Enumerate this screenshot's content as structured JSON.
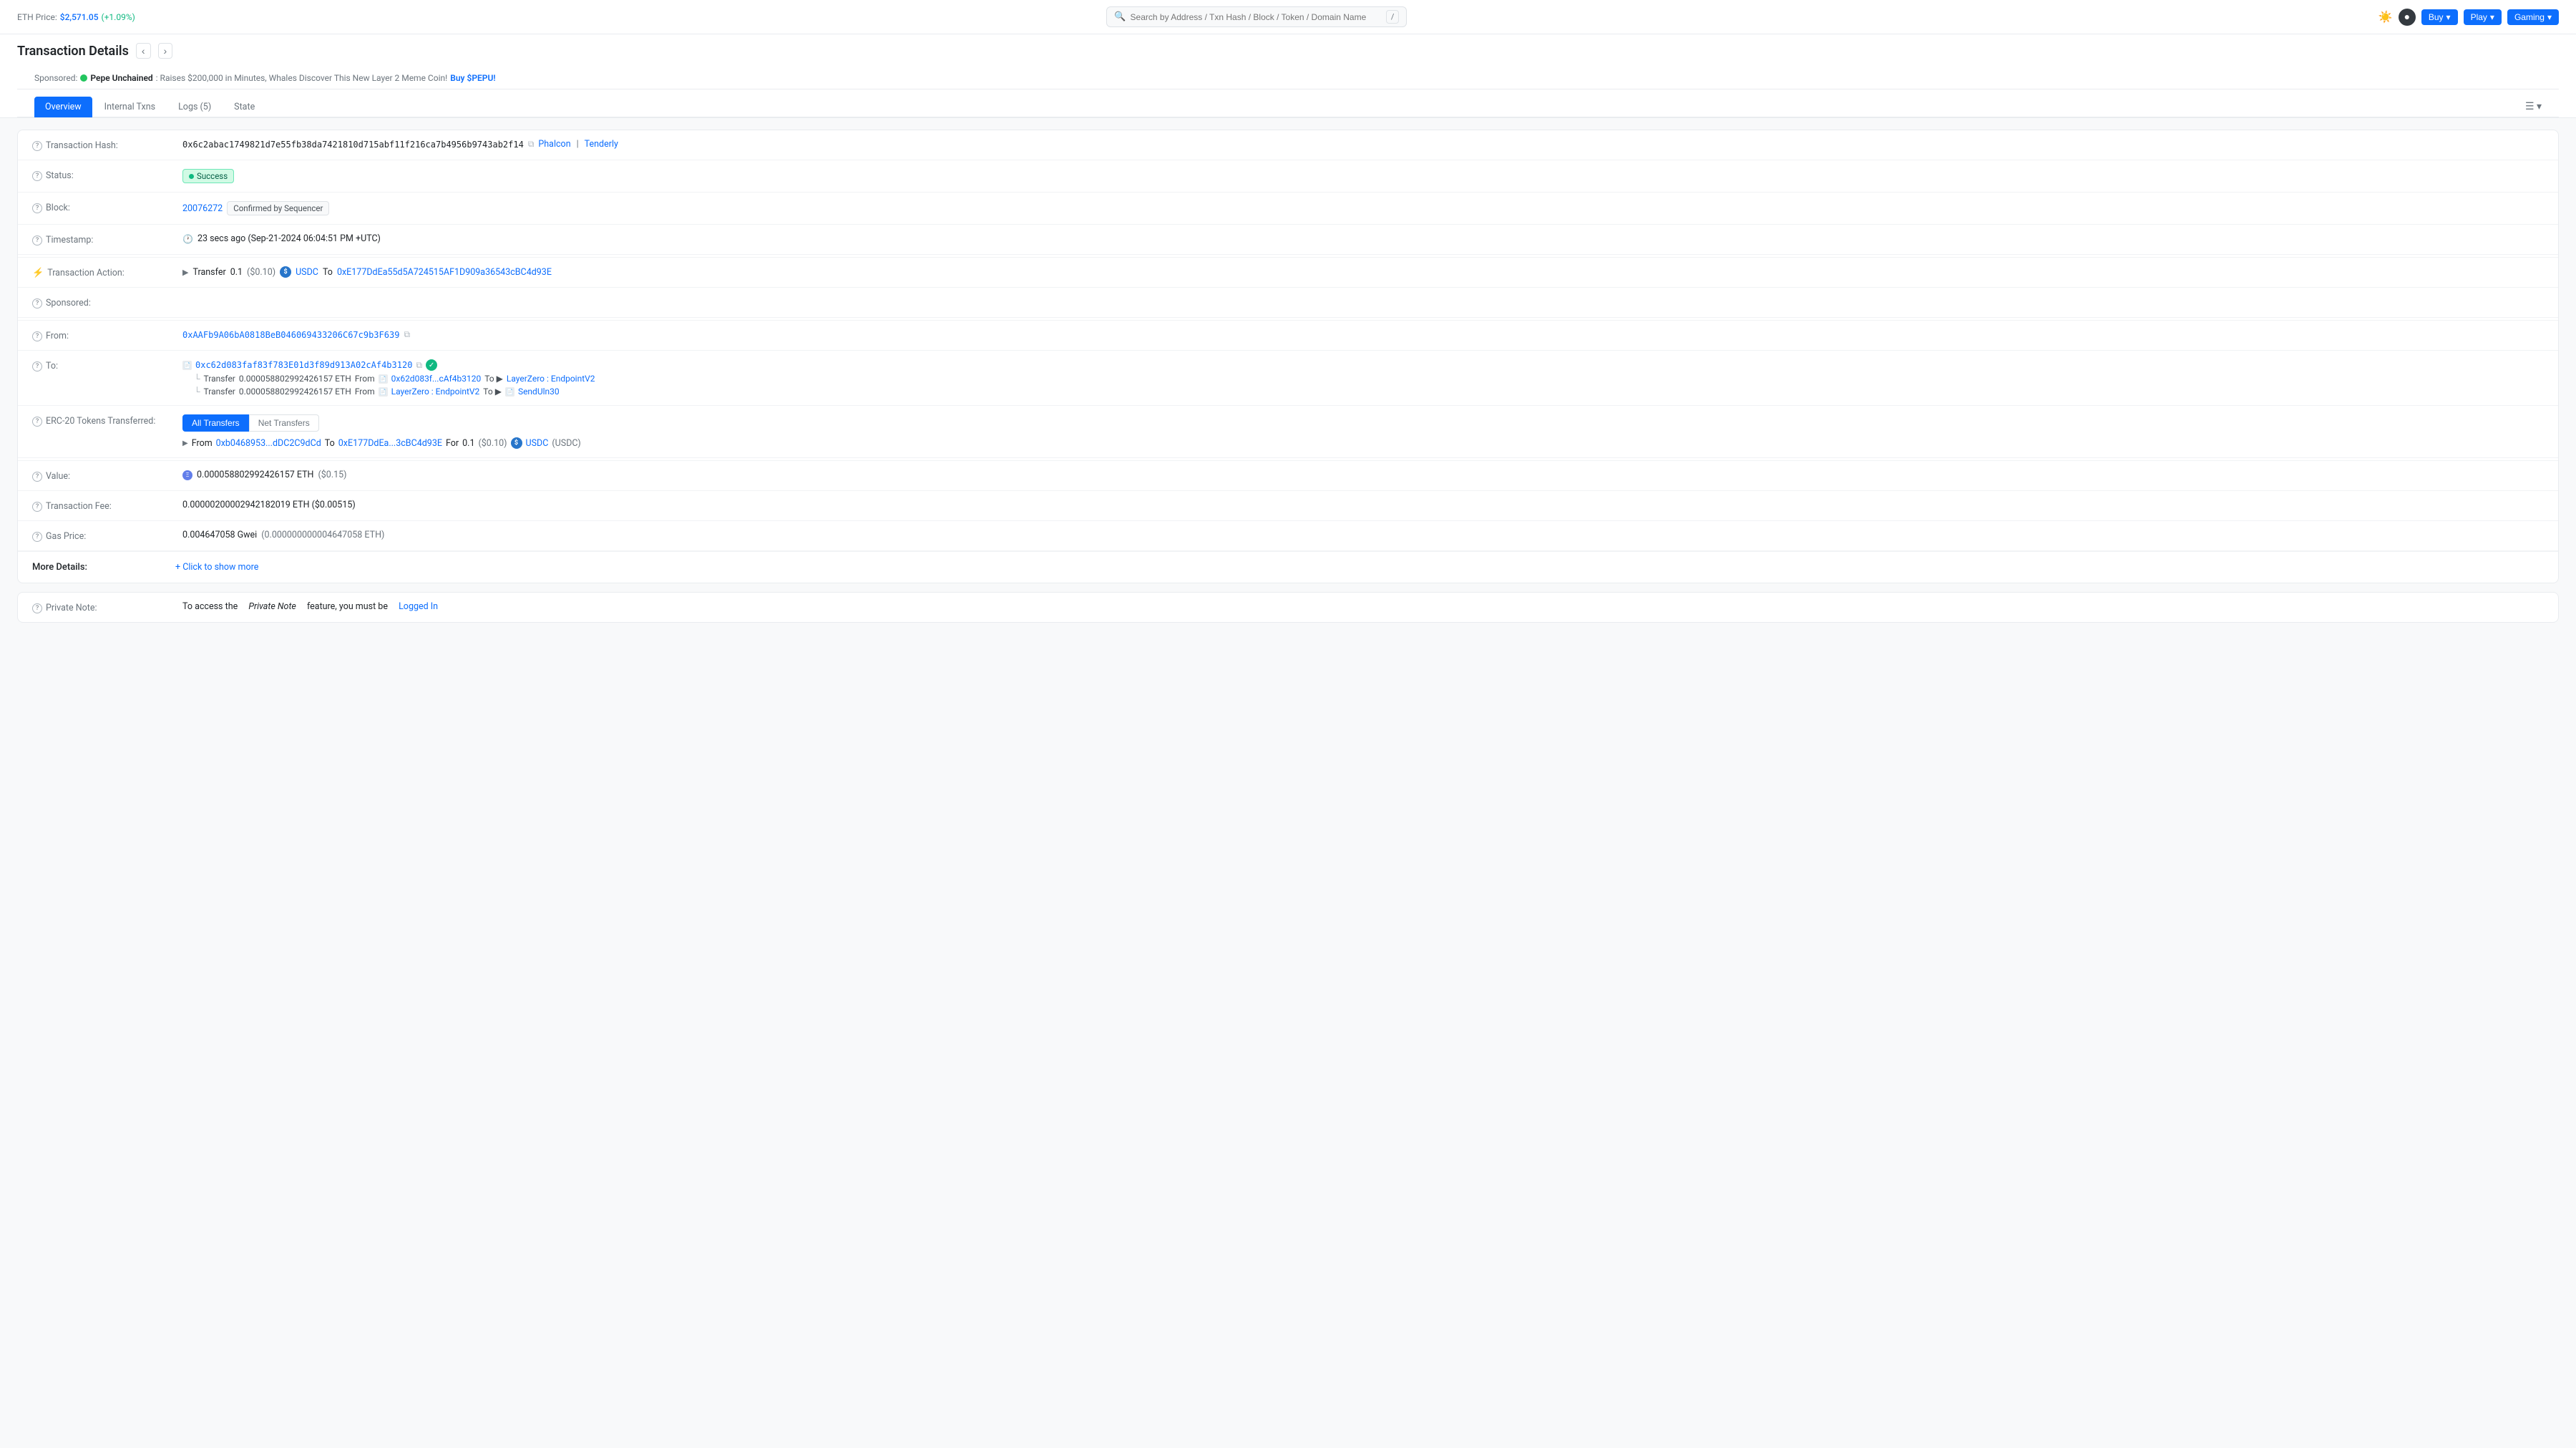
{
  "topNav": {
    "ethLabel": "ETH Price:",
    "ethValue": "$2,571.05",
    "ethChange": "(+1.09%)",
    "searchPlaceholder": "Search by Address / Txn Hash / Block / Token / Domain Name",
    "slashKey": "/",
    "buyLabel": "Buy",
    "playLabel": "Play",
    "gamingLabel": "Gaming"
  },
  "pageHeader": {
    "title": "Transaction Details"
  },
  "sponsored": {
    "label": "Sponsored:",
    "projectName": "Pepe Unchained",
    "text": ": Raises $200,000 in Minutes, Whales Discover This New Layer 2 Meme Coin!",
    "linkText": "Buy $PEPU!",
    "dotColor": "#22c55e"
  },
  "tabs": {
    "items": [
      {
        "label": "Overview",
        "active": true
      },
      {
        "label": "Internal Txns",
        "active": false
      },
      {
        "label": "Logs (5)",
        "active": false
      },
      {
        "label": "State",
        "active": false
      }
    ]
  },
  "details": {
    "txHashLabel": "Transaction Hash:",
    "txHashValue": "0x6c2abac1749821d7e55fb38da7421810d715abf11f216ca7b4956b9743ab2f14",
    "phalconLabel": "Phalcon",
    "tenderlyLabel": "Tenderly",
    "statusLabel": "Status:",
    "statusValue": "Success",
    "blockLabel": "Block:",
    "blockValue": "20076272",
    "confirmedLabel": "Confirmed by Sequencer",
    "timestampLabel": "Timestamp:",
    "timestampValue": "23 secs ago (Sep-21-2024 06:04:51 PM +UTC)",
    "txActionLabel": "Transaction Action:",
    "txActionValue": "Transfer",
    "txActionAmount": "0.1",
    "txActionUSD": "($0.10)",
    "txActionToken": "USDC",
    "txActionTo": "To",
    "txActionAddress": "0xE177DdEa55d5A724515AF1D909a36543cBC4d93E",
    "sponsoredLabel": "Sponsored:",
    "fromLabel": "From:",
    "fromAddress": "0xAAFb9A06bA0818BeB046069433206C67c9b3F639",
    "toLabel": "To:",
    "toAddress": "0xc62d083faf83f783E01d3f89d913A02cAf4b3120",
    "transfer1From": "0x62d083f...cAf4b3120",
    "transfer1To1": "LayerZero : EndpointV2",
    "transfer1Amount": "0.000058802992426157 ETH",
    "transfer2From": "LayerZero : EndpointV2",
    "transfer2To": "SendUln30",
    "transfer2Amount": "0.000058802992426157 ETH",
    "erc20Label": "ERC-20 Tokens Transferred:",
    "allTransfersTab": "All Transfers",
    "netTransfersTab": "Net Transfers",
    "tokenFrom": "0xb0468953...dDC2C9dCd",
    "tokenTo": "0xE177DdEa...3cBC4d93E",
    "tokenFor": "For",
    "tokenAmount": "0.1",
    "tokenUSD": "($0.10)",
    "tokenSymbol": "USDC",
    "tokenFull": "(USDC)",
    "valueLabel": "Value:",
    "valueEth": "0.000058802992426157 ETH",
    "valueUSD": "($0.15)",
    "txFeeLabel": "Transaction Fee:",
    "txFeeValue": "0.00000200002942182019 ETH ($0.00515)",
    "gasPriceLabel": "Gas Price:",
    "gasPriceValue": "0.004647058 Gwei",
    "gasPriceDetail": "(0.000000000004647058 ETH)",
    "moreDetailsLabel": "More Details:",
    "moreDetailsLink": "+ Click to show more",
    "privateNoteLabel": "Private Note:",
    "privateNoteText": "To access the",
    "privateNoteMiddle": "Private Note",
    "privateNoteEnd": "feature, you must be",
    "privateNoteLink": "Logged In"
  }
}
